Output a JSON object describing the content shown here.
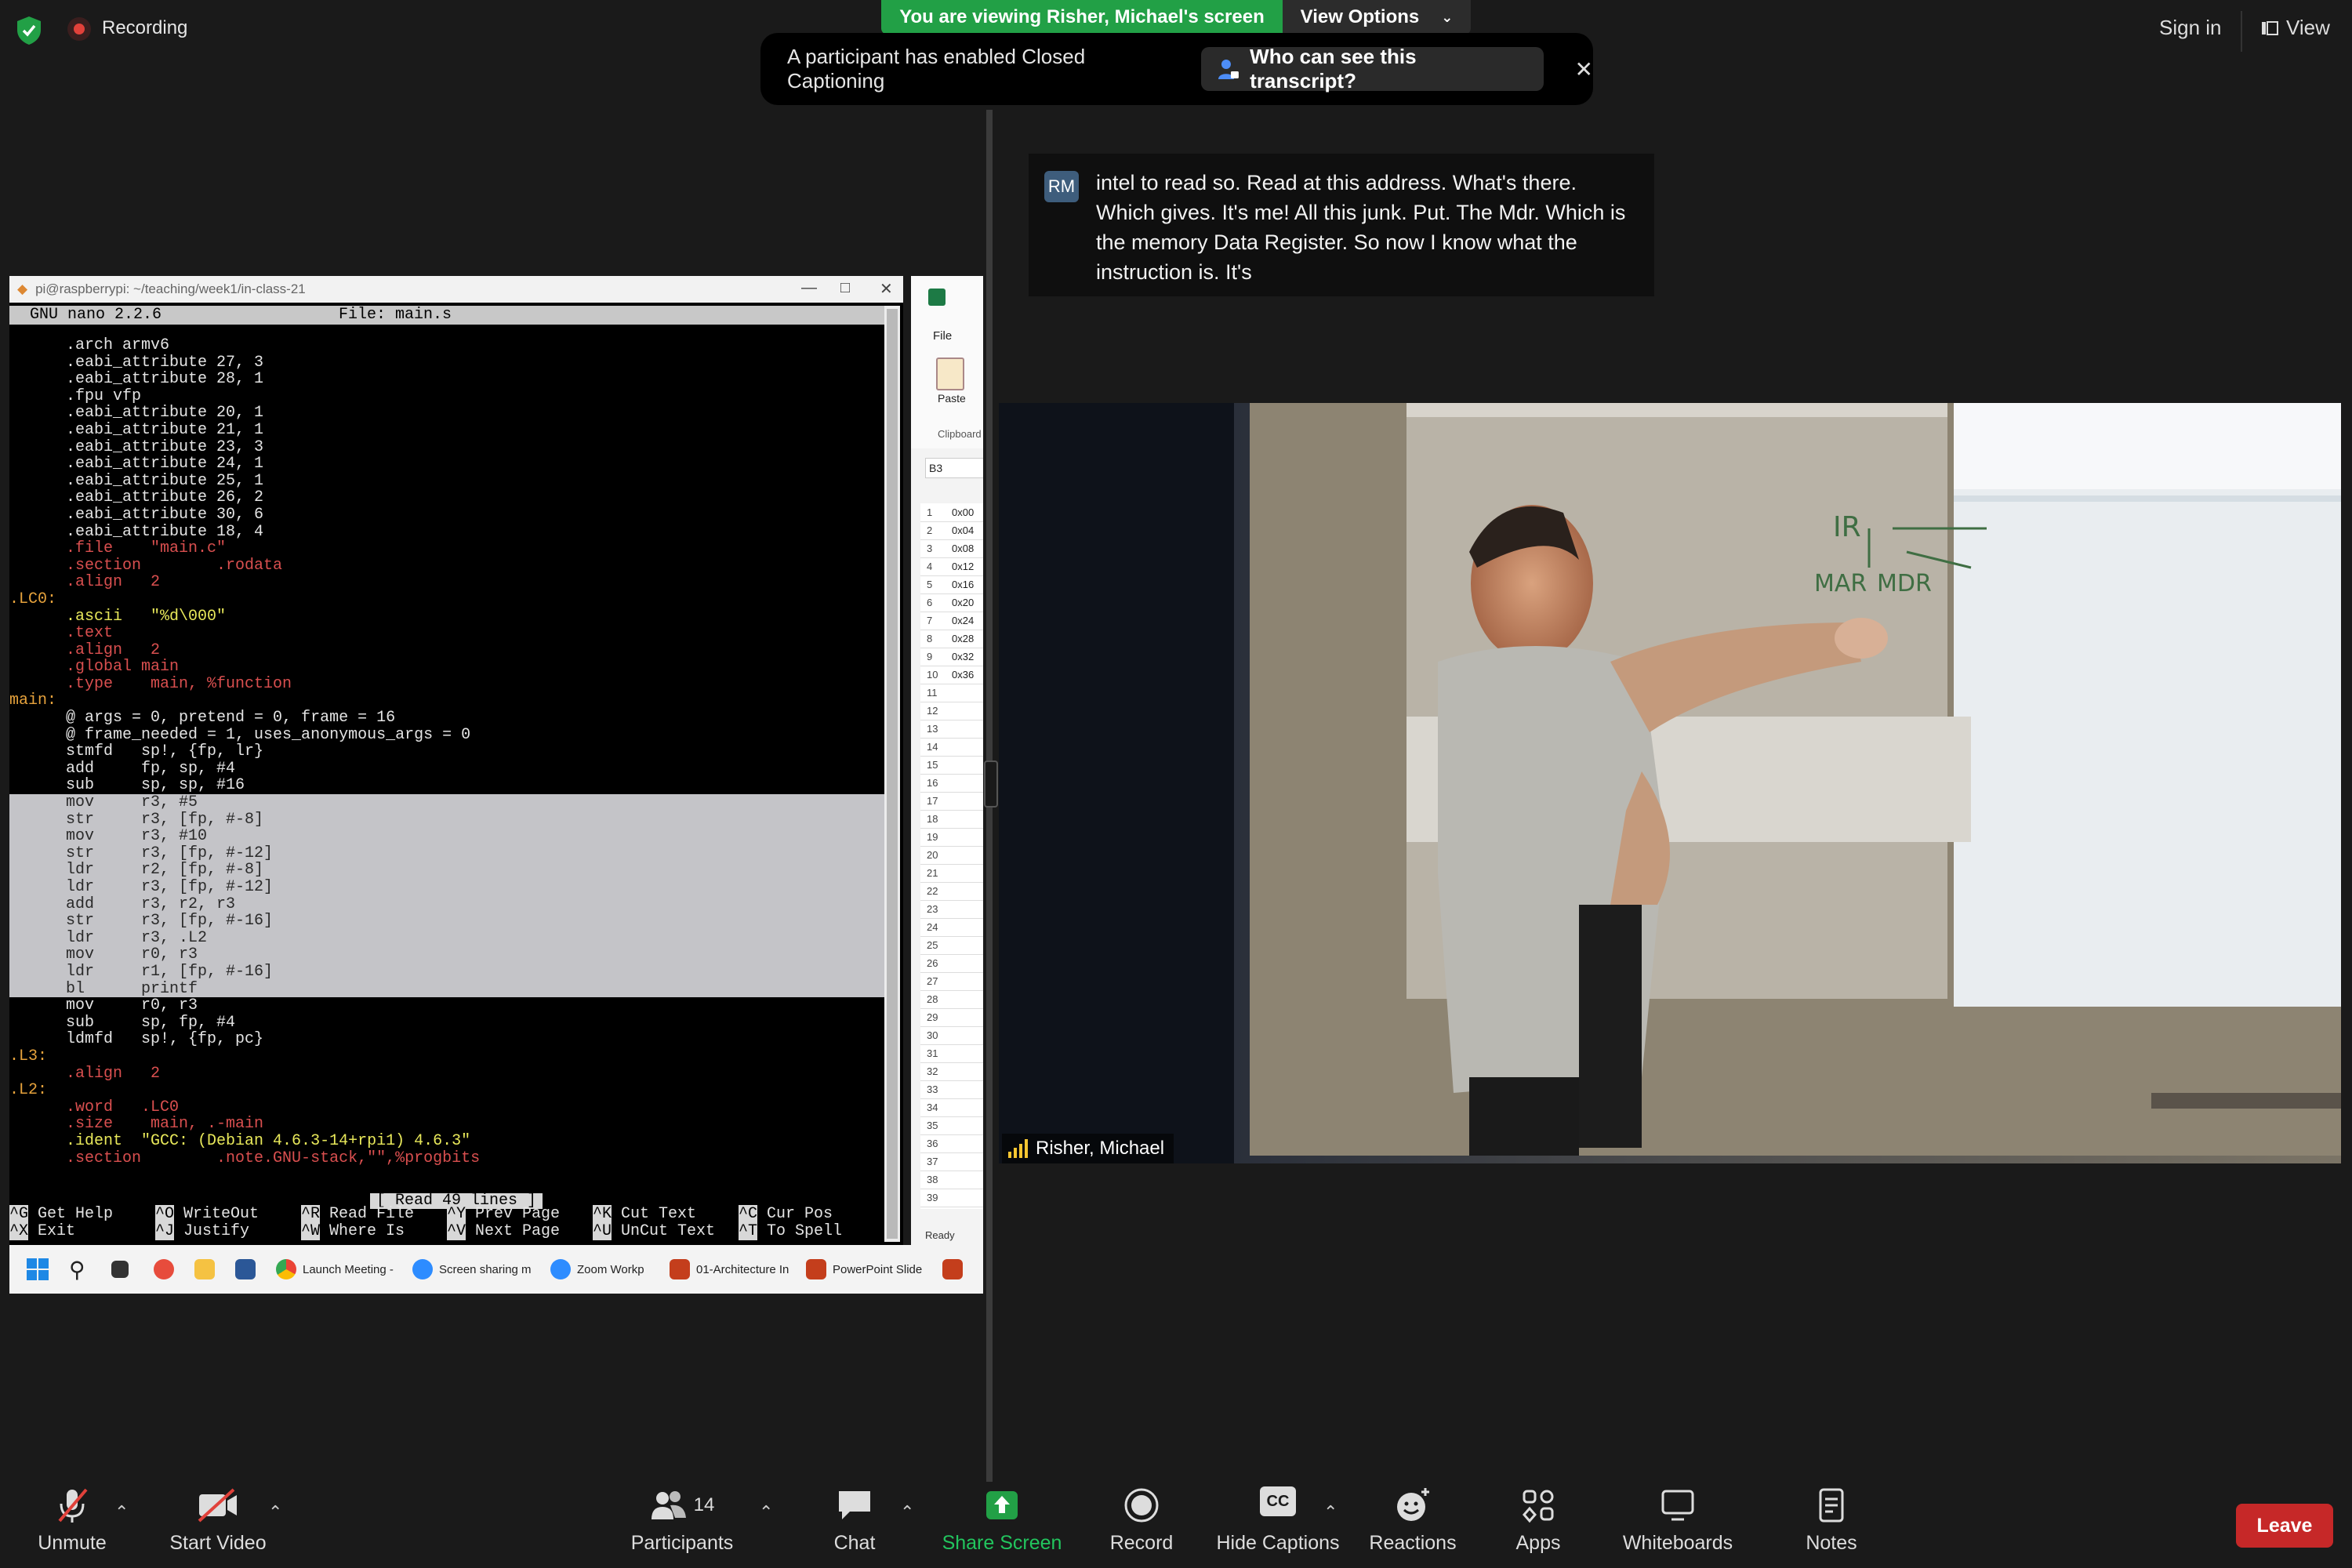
{
  "topbar": {
    "recording_label": "Recording",
    "viewing_banner": "You are viewing Risher, Michael's screen",
    "view_options_label": "View Options",
    "sign_in_label": "Sign in",
    "view_label": "View"
  },
  "caption_notice": {
    "text": "A participant has enabled Closed Captioning",
    "who_button": "Who can see this transcript?"
  },
  "terminal": {
    "window_title": "pi@raspberrypi: ~/teaching/week1/in-class-21",
    "app": "GNU nano 2.2.6",
    "file": "File: main.s",
    "status": "[ Read 49 lines ]",
    "lines": [
      {
        "t": "      .arch armv6",
        "c": ""
      },
      {
        "t": "      .eabi_attribute 27, 3",
        "c": ""
      },
      {
        "t": "      .eabi_attribute 28, 1",
        "c": ""
      },
      {
        "t": "      .fpu vfp",
        "c": ""
      },
      {
        "t": "      .eabi_attribute 20, 1",
        "c": ""
      },
      {
        "t": "      .eabi_attribute 21, 1",
        "c": ""
      },
      {
        "t": "      .eabi_attribute 23, 3",
        "c": ""
      },
      {
        "t": "      .eabi_attribute 24, 1",
        "c": ""
      },
      {
        "t": "      .eabi_attribute 25, 1",
        "c": ""
      },
      {
        "t": "      .eabi_attribute 26, 2",
        "c": ""
      },
      {
        "t": "      .eabi_attribute 30, 6",
        "c": ""
      },
      {
        "t": "      .eabi_attribute 18, 4",
        "c": ""
      },
      {
        "t": "      .file    \"main.c\"",
        "c": "dir"
      },
      {
        "t": "      .section        .rodata",
        "c": "dir"
      },
      {
        "t": "      .align   2",
        "c": "dir"
      },
      {
        "t": ".LC0:",
        "c": "lbl"
      },
      {
        "t": "      .ascii   \"%d\\000\"",
        "c": "str"
      },
      {
        "t": "      .text",
        "c": "dir"
      },
      {
        "t": "      .align   2",
        "c": "dir"
      },
      {
        "t": "      .global main",
        "c": "dir"
      },
      {
        "t": "      .type    main, %function",
        "c": "dir"
      },
      {
        "t": "main:",
        "c": "lbl"
      },
      {
        "t": "      @ args = 0, pretend = 0, frame = 16",
        "c": ""
      },
      {
        "t": "      @ frame_needed = 1, uses_anonymous_args = 0",
        "c": ""
      },
      {
        "t": "      stmfd   sp!, {fp, lr}",
        "c": ""
      },
      {
        "t": "      add     fp, sp, #4",
        "c": ""
      },
      {
        "t": "      sub     sp, sp, #16",
        "c": ""
      },
      {
        "t": "      mov     r3, #5",
        "c": "hl"
      },
      {
        "t": "      str     r3, [fp, #-8]",
        "c": "hl"
      },
      {
        "t": "      mov     r3, #10",
        "c": "hl"
      },
      {
        "t": "      str     r3, [fp, #-12]",
        "c": "hl"
      },
      {
        "t": "      ldr     r2, [fp, #-8]",
        "c": "hl"
      },
      {
        "t": "      ldr     r3, [fp, #-12]",
        "c": "hl"
      },
      {
        "t": "      add     r3, r2, r3",
        "c": "hl"
      },
      {
        "t": "      str     r3, [fp, #-16]",
        "c": "hl"
      },
      {
        "t": "      ldr     r3, .L2",
        "c": "hl"
      },
      {
        "t": "      mov     r0, r3",
        "c": "hl"
      },
      {
        "t": "      ldr     r1, [fp, #-16]",
        "c": "hl"
      },
      {
        "t": "      bl      printf",
        "c": "hl"
      },
      {
        "t": "      mov     r0, r3",
        "c": ""
      },
      {
        "t": "      sub     sp, fp, #4",
        "c": ""
      },
      {
        "t": "      ldmfd   sp!, {fp, pc}",
        "c": ""
      },
      {
        "t": ".L3:",
        "c": "lbl"
      },
      {
        "t": "      .align   2",
        "c": "dir"
      },
      {
        "t": ".L2:",
        "c": "lbl"
      },
      {
        "t": "      .word   .LC0",
        "c": "dir"
      },
      {
        "t": "      .size    main, .-main",
        "c": "dir"
      },
      {
        "t": "      .ident  \"GCC: (Debian 4.6.3-14+rpi1) 4.6.3\"",
        "c": "str"
      },
      {
        "t": "      .section        .note.GNU-stack,\"\",%progbits",
        "c": "dir"
      }
    ],
    "shortcuts": [
      {
        "key": "^G",
        "label": "Get Help"
      },
      {
        "key": "^O",
        "label": "WriteOut"
      },
      {
        "key": "^R",
        "label": "Read File"
      },
      {
        "key": "^Y",
        "label": "Prev Page"
      },
      {
        "key": "^K",
        "label": "Cut Text"
      },
      {
        "key": "^C",
        "label": "Cur Pos"
      },
      {
        "key": "^X",
        "label": "Exit"
      },
      {
        "key": "^J",
        "label": "Justify"
      },
      {
        "key": "^W",
        "label": "Where Is"
      },
      {
        "key": "^V",
        "label": "Next Page"
      },
      {
        "key": "^U",
        "label": "UnCut Text"
      },
      {
        "key": "^T",
        "label": "To Spell"
      }
    ]
  },
  "excel": {
    "file_tab": "File",
    "paste_label": "Paste",
    "clipboard_label": "Clipboard",
    "cell_ref": "B3",
    "ready_label": "Ready",
    "rows": [
      "1",
      "2",
      "3",
      "4",
      "5",
      "6",
      "7",
      "8",
      "9",
      "10",
      "11",
      "12",
      "13",
      "14",
      "15",
      "16",
      "17",
      "18",
      "19",
      "20",
      "21",
      "22",
      "23",
      "24",
      "25",
      "26",
      "27",
      "28",
      "29",
      "30",
      "31",
      "32",
      "33",
      "34",
      "35",
      "36",
      "37",
      "38",
      "39"
    ],
    "values": [
      "0x00",
      "0x04",
      "0x08",
      "0x12",
      "0x16",
      "0x20",
      "0x24",
      "0x28",
      "0x32",
      "0x36"
    ]
  },
  "taskbar": {
    "items": [
      "Launch Meeting -",
      "Screen sharing m",
      "Zoom Workp",
      "01-Architecture In",
      "PowerPoint Slide"
    ]
  },
  "transcript": {
    "initials": "RM",
    "text": "intel to read so. Read at this address. What's there. Which gives. It's me! All this junk. Put. The Mdr. Which is the memory Data Register. So now I know what the instruction is. It's"
  },
  "video": {
    "participant_name": "Risher, Michael",
    "whiteboard_notes": [
      "IR",
      "MAR",
      "MDR"
    ]
  },
  "toolbar": {
    "unmute": "Unmute",
    "start_video": "Start Video",
    "participants": "Participants",
    "participant_count": "14",
    "chat": "Chat",
    "share_screen": "Share Screen",
    "record": "Record",
    "hide_captions": "Hide Captions",
    "cc_icon": "CC",
    "reactions": "Reactions",
    "apps": "Apps",
    "whiteboards": "Whiteboards",
    "notes": "Notes",
    "leave": "Leave"
  },
  "colors": {
    "viewing_banner": "#22a046",
    "leave": "#c62828",
    "share_screen": "#22a046",
    "recording_dot": "#e0413a"
  }
}
